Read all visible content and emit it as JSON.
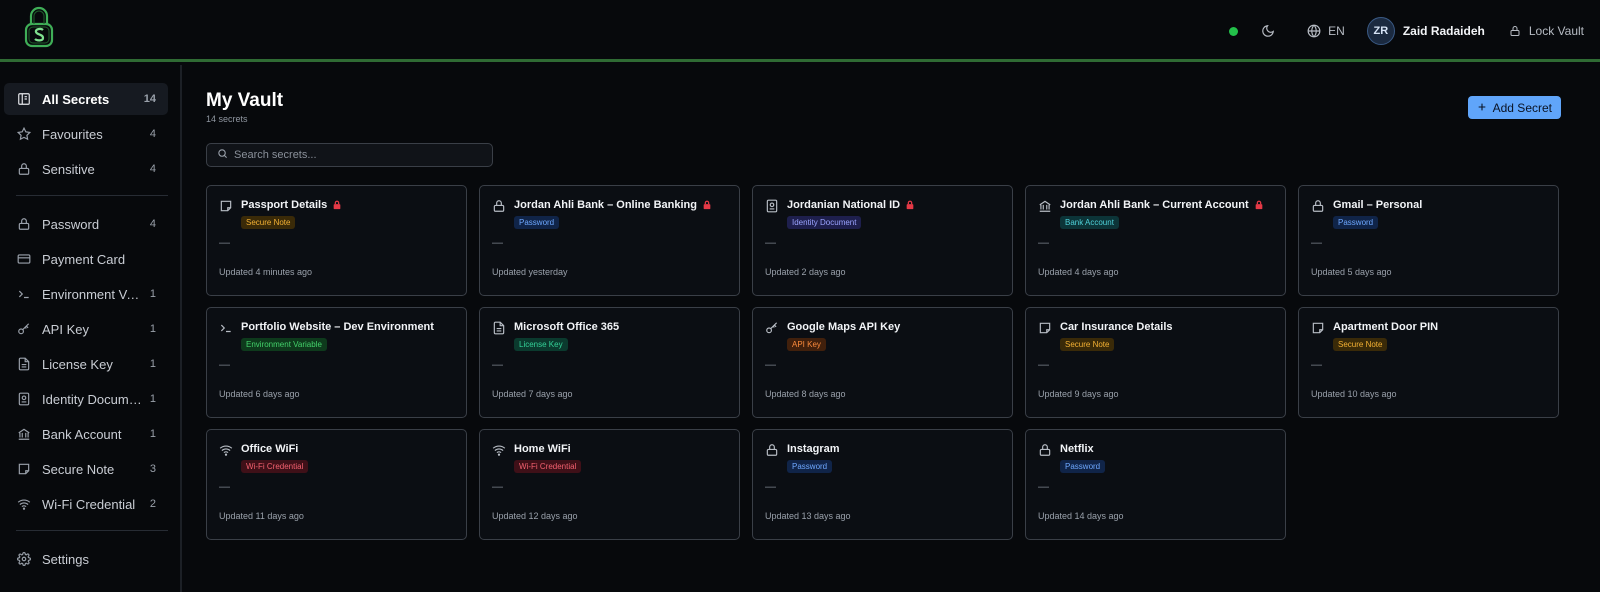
{
  "header": {
    "language": "EN",
    "avatar_initials": "ZR",
    "user_name": "Zaid Radaideh",
    "lock_label": "Lock Vault",
    "status_color": "#23c04a",
    "accent_color": "#2f6b34"
  },
  "sidebar": {
    "top": [
      {
        "label": "All Secrets",
        "count": "14",
        "icon": "book-icon",
        "active": true
      },
      {
        "label": "Favourites",
        "count": "4",
        "icon": "star-icon"
      },
      {
        "label": "Sensitive",
        "count": "4",
        "icon": "lock-icon"
      }
    ],
    "types": [
      {
        "label": "Password",
        "count": "4",
        "icon": "lock-icon"
      },
      {
        "label": "Payment Card",
        "count": "",
        "icon": "card-icon"
      },
      {
        "label": "Environment Variable",
        "count": "1",
        "icon": "terminal-icon"
      },
      {
        "label": "API Key",
        "count": "1",
        "icon": "key-icon"
      },
      {
        "label": "License Key",
        "count": "1",
        "icon": "file-icon"
      },
      {
        "label": "Identity Document",
        "count": "1",
        "icon": "id-icon"
      },
      {
        "label": "Bank Account",
        "count": "1",
        "icon": "bank-icon"
      },
      {
        "label": "Secure Note",
        "count": "3",
        "icon": "note-icon"
      },
      {
        "label": "Wi-Fi Credential",
        "count": "2",
        "icon": "wifi-icon"
      }
    ],
    "settings_label": "Settings"
  },
  "main": {
    "title": "My Vault",
    "subtitle": "14 secrets",
    "add_label": "Add Secret",
    "search_placeholder": "Search secrets...",
    "add_color": "#60a5fa"
  },
  "cards": [
    {
      "title": "Passport Details",
      "sensitive": true,
      "badge": "Secure Note",
      "badge_style": "note",
      "icon": "note-icon",
      "value": "—",
      "updated": "Updated 4 minutes ago"
    },
    {
      "title": "Jordan Ahli Bank – Online Banking",
      "sensitive": true,
      "badge": "Password",
      "badge_style": "password",
      "icon": "lock-icon",
      "value": "—",
      "updated": "Updated yesterday"
    },
    {
      "title": "Jordanian National ID",
      "sensitive": true,
      "badge": "Identity Document",
      "badge_style": "identity",
      "icon": "id-icon",
      "value": "—",
      "updated": "Updated 2 days ago"
    },
    {
      "title": "Jordan Ahli Bank – Current Account",
      "sensitive": true,
      "badge": "Bank Account",
      "badge_style": "bank",
      "icon": "bank-icon",
      "value": "—",
      "updated": "Updated 4 days ago"
    },
    {
      "title": "Gmail – Personal",
      "sensitive": false,
      "badge": "Password",
      "badge_style": "password",
      "icon": "lock-icon",
      "value": "—",
      "updated": "Updated 5 days ago"
    },
    {
      "title": "Portfolio Website – Dev Environment",
      "sensitive": false,
      "badge": "Environment Variable",
      "badge_style": "env",
      "icon": "terminal-icon",
      "value": "—",
      "updated": "Updated 6 days ago"
    },
    {
      "title": "Microsoft Office 365",
      "sensitive": false,
      "badge": "License Key",
      "badge_style": "license",
      "icon": "file-icon",
      "value": "—",
      "updated": "Updated 7 days ago"
    },
    {
      "title": "Google Maps API Key",
      "sensitive": false,
      "badge": "API Key",
      "badge_style": "api",
      "icon": "key-icon",
      "value": "—",
      "updated": "Updated 8 days ago"
    },
    {
      "title": "Car Insurance Details",
      "sensitive": false,
      "badge": "Secure Note",
      "badge_style": "note",
      "icon": "note-icon",
      "value": "—",
      "updated": "Updated 9 days ago"
    },
    {
      "title": "Apartment Door PIN",
      "sensitive": false,
      "badge": "Secure Note",
      "badge_style": "note",
      "icon": "note-icon",
      "value": "—",
      "updated": "Updated 10 days ago"
    },
    {
      "title": "Office WiFi",
      "sensitive": false,
      "badge": "Wi-Fi Credential",
      "badge_style": "wifi",
      "icon": "wifi-icon",
      "value": "—",
      "updated": "Updated 11 days ago"
    },
    {
      "title": "Home WiFi",
      "sensitive": false,
      "badge": "Wi-Fi Credential",
      "badge_style": "wifi",
      "icon": "wifi-icon",
      "value": "—",
      "updated": "Updated 12 days ago"
    },
    {
      "title": "Instagram",
      "sensitive": false,
      "badge": "Password",
      "badge_style": "password",
      "icon": "lock-icon",
      "value": "—",
      "updated": "Updated 13 days ago"
    },
    {
      "title": "Netflix",
      "sensitive": false,
      "badge": "Password",
      "badge_style": "password",
      "icon": "lock-icon",
      "value": "—",
      "updated": "Updated 14 days ago"
    }
  ],
  "badge_colors": {
    "note": {
      "bg": "#3a2a08",
      "fg": "#f5b234"
    },
    "password": {
      "bg": "#102448",
      "fg": "#6ea8ff"
    },
    "identity": {
      "bg": "#1e1f4d",
      "fg": "#9ba4ff"
    },
    "bank": {
      "bg": "#0c3438",
      "fg": "#4fd1d9"
    },
    "env": {
      "bg": "#0e3a1c",
      "fg": "#43d36b"
    },
    "license": {
      "bg": "#0b3a2e",
      "fg": "#34d399"
    },
    "api": {
      "bg": "#41200c",
      "fg": "#fb8a3c"
    },
    "wifi": {
      "bg": "#3f1018",
      "fg": "#f2606f"
    }
  }
}
